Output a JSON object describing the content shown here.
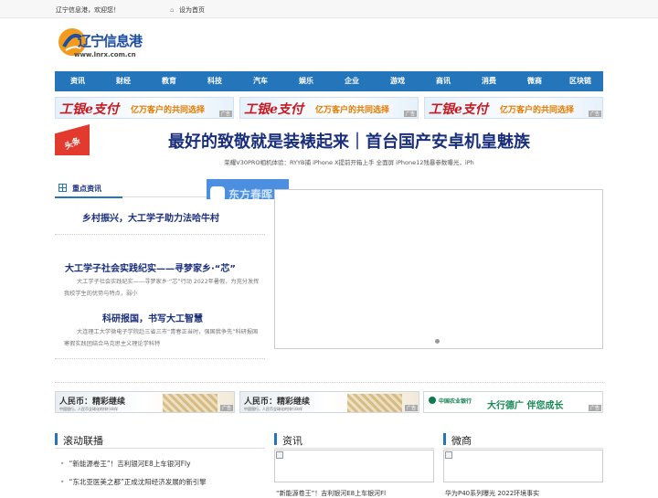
{
  "topbar": {
    "welcome": "辽宁信息港，欢迎您！",
    "set_home": "设为首页"
  },
  "logo": {
    "name": "辽宁信息港",
    "url": "www.lnrx.com.cn"
  },
  "nav": [
    "资讯",
    "财经",
    "教育",
    "科技",
    "汽车",
    "娱乐",
    "企业",
    "游戏",
    "商讯",
    "消费",
    "微商",
    "区块链"
  ],
  "banner_ads": [
    {
      "brand": "工银e支付",
      "slogan": "亿万客户的共同选择",
      "tag": "广告"
    },
    {
      "brand": "工银e支付",
      "slogan": "亿万客户的共同选择",
      "tag": "广告"
    },
    {
      "brand": "工银e支付",
      "slogan": "亿万客户的共同选择",
      "tag": "广告"
    }
  ],
  "headline": {
    "badge": "头条",
    "title": "最好的致敬就是装裱起来｜首台国产安卓机皇魅族",
    "sub": "荣耀V30PRO相机体验：RYYB捕   iPhone X提前开箱上手 全面屏   iPhone12残暴参数曝光，iPh"
  },
  "key_news": {
    "title": "重点资讯",
    "thumb_text": "东方春晖",
    "items": [
      {
        "title": "乡村振兴，大工学子助力法哈牛村",
        "desc": ""
      },
      {
        "title": "大工学子社会实践纪实——寻梦家乡·“芯”",
        "desc": "大工学子社会实践纪实——寻梦家乡·“芯”行动 2022年暑假，为充分发挥我校学生的优势与特点，弱小"
      },
      {
        "title": "科研报国，书写大工智慧",
        "desc": "大连理工大学微电子学院赴三省三市“青春正当时，强国我争先”科研报国寒假实践团结合马克思主义理论学科特"
      }
    ]
  },
  "mid_ads": [
    {
      "brand": "人民币：精彩继续",
      "small": "中国银行，人民币全球化的排行伙伴",
      "tag": "广告"
    },
    {
      "brand": "人民币：精彩继续",
      "small": "中国银行，人民币全球化的排行伙伴",
      "tag": "广告"
    },
    {
      "bank": "中国农业银行",
      "slogan": "大行德广 伴您成长",
      "tag": "广告"
    }
  ],
  "columns": {
    "rolling": {
      "title": "滚动联播",
      "items": [
        "“新能源卷王”！吉利银河E8上车银河Fly",
        "“东北亚医美之都”正成沈阳经济发展的新引擎"
      ]
    },
    "news": {
      "title": "资讯",
      "peek": "“新能源卷王”！吉利银河E8上车银河Fl"
    },
    "weishang": {
      "title": "微商",
      "peek": "华为P40系列曝光 2022环境事实"
    }
  }
}
